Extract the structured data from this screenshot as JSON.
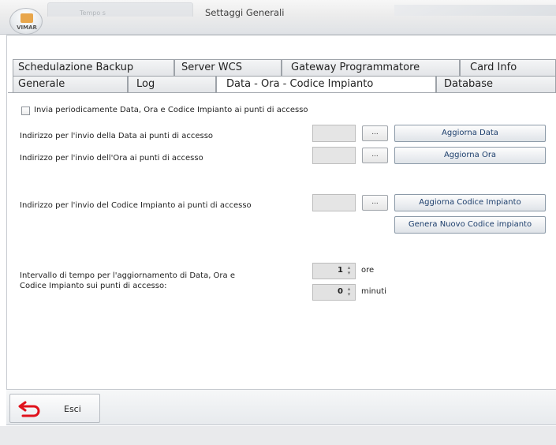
{
  "window": {
    "title": "Settaggi Generali",
    "logo_text": "VIMAR",
    "ghost_tab": "Tempo s"
  },
  "tabs": {
    "row1": [
      "Schedulazione Backup",
      "Server WCS",
      "Gateway Programmatore",
      "Card Info"
    ],
    "row2": [
      "Generale",
      "Log",
      "Data - Ora - Codice Impianto",
      "Database"
    ],
    "active": "Data - Ora - Codice Impianto"
  },
  "content": {
    "checkbox_label": "Invia periodicamente Data, Ora e Codice Impianto ai punti di accesso",
    "checkbox_checked": false,
    "date_address_label": "Indirizzo per l'invio della Data ai punti di accesso",
    "time_address_label": "Indirizzo per l'invio dell'Ora ai punti di accesso",
    "code_address_label": "Indirizzo per l'invio del Codice Impianto ai punti di accesso",
    "browse_label": "...",
    "update_date_button": "Aggiorna Data",
    "update_time_button": "Aggiorna Ora",
    "update_code_button": "Aggiorna Codice Impianto",
    "generate_code_button": "Genera Nuovo Codice impianto",
    "interval_label_line1": "Intervallo di tempo per l'aggiornamento di Data, Ora e",
    "interval_label_line2": "Codice Impianto sui punti di accesso:",
    "hours_value": "1",
    "hours_unit": "ore",
    "minutes_value": "0",
    "minutes_unit": "minuti"
  },
  "footer": {
    "exit_label": "Esci"
  },
  "colors": {
    "exit_icon": "#e0121c",
    "button_text": "#1b3d6b"
  }
}
